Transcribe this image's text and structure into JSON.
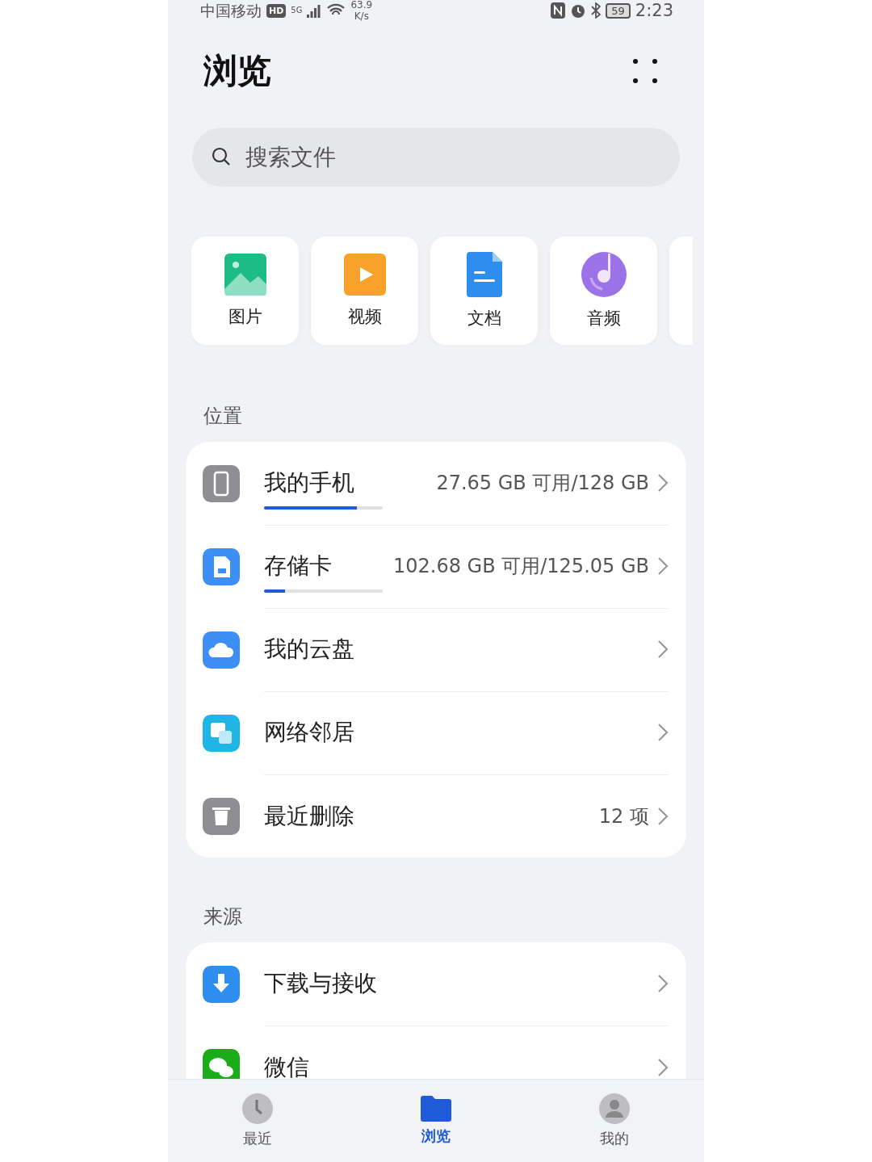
{
  "status_bar": {
    "carrier": "中国移动",
    "hd": "HD",
    "network": "5G",
    "speed": "63.9",
    "speed_unit": "K/s",
    "battery": "59",
    "time": "2:23"
  },
  "title": "浏览",
  "search": {
    "placeholder": "搜索文件"
  },
  "categories": [
    {
      "kind": "image",
      "label": "图片"
    },
    {
      "kind": "video",
      "label": "视频"
    },
    {
      "kind": "doc",
      "label": "文档"
    },
    {
      "kind": "audio",
      "label": "音频"
    },
    {
      "kind": "partial"
    }
  ],
  "sections": [
    {
      "title": "位置",
      "items": [
        {
          "kind": "phone",
          "label": "我的手机",
          "detail": "27.65 GB 可用/128 GB",
          "level": 0.78
        },
        {
          "kind": "sdcard",
          "label": "存储卡",
          "detail": "102.68 GB 可用/125.05 GB",
          "level": 0.18
        },
        {
          "kind": "cloud",
          "label": "我的云盘"
        },
        {
          "kind": "network",
          "label": "网络邻居"
        },
        {
          "kind": "trash",
          "label": "最近删除",
          "detail": "12 项"
        }
      ]
    },
    {
      "title": "来源",
      "items": [
        {
          "kind": "download",
          "label": "下载与接收"
        },
        {
          "kind": "wechat",
          "label": "微信"
        }
      ]
    }
  ],
  "nav": [
    {
      "kind": "recent",
      "label": "最近",
      "selected": false
    },
    {
      "kind": "browse",
      "label": "浏览",
      "selected": true
    },
    {
      "kind": "mine",
      "label": "我的",
      "selected": false
    }
  ]
}
